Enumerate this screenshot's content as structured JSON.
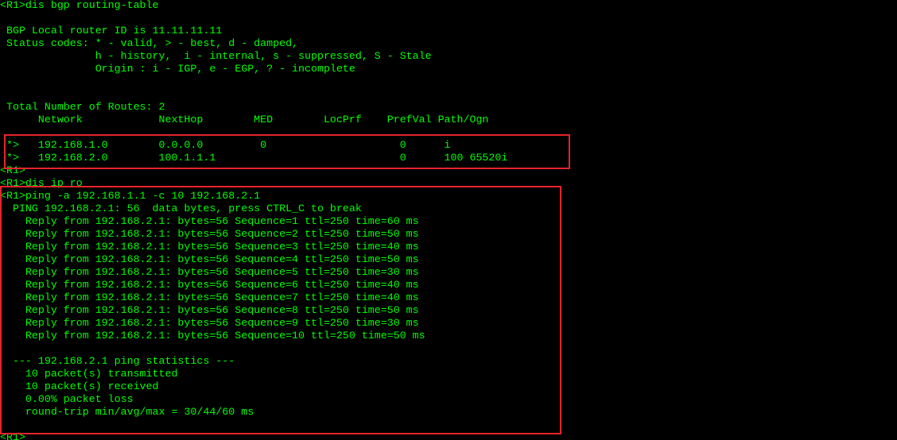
{
  "colors": {
    "background": "#000000",
    "text": "#00ff00",
    "highlight": "#e8232a"
  },
  "lines": [
    "<R1>dis bgp routing-table",
    "",
    " BGP Local router ID is 11.11.11.11",
    " Status codes: * - valid, > - best, d - damped,",
    "               h - history,  i - internal, s - suppressed, S - Stale",
    "               Origin : i - IGP, e - EGP, ? - incomplete",
    "",
    "",
    " Total Number of Routes: 2",
    "      Network            NextHop        MED        LocPrf    PrefVal Path/Ogn",
    "",
    " *>   192.168.1.0        0.0.0.0         0                     0      i",
    " *>   192.168.2.0        100.1.1.1                             0      100 65520i",
    "<R1>",
    "<R1>dis ip ro",
    "<R1>ping -a 192.168.1.1 -c 10 192.168.2.1",
    "  PING 192.168.2.1: 56  data bytes, press CTRL_C to break",
    "    Reply from 192.168.2.1: bytes=56 Sequence=1 ttl=250 time=60 ms",
    "    Reply from 192.168.2.1: bytes=56 Sequence=2 ttl=250 time=50 ms",
    "    Reply from 192.168.2.1: bytes=56 Sequence=3 ttl=250 time=40 ms",
    "    Reply from 192.168.2.1: bytes=56 Sequence=4 ttl=250 time=50 ms",
    "    Reply from 192.168.2.1: bytes=56 Sequence=5 ttl=250 time=30 ms",
    "    Reply from 192.168.2.1: bytes=56 Sequence=6 ttl=250 time=40 ms",
    "    Reply from 192.168.2.1: bytes=56 Sequence=7 ttl=250 time=40 ms",
    "    Reply from 192.168.2.1: bytes=56 Sequence=8 ttl=250 time=50 ms",
    "    Reply from 192.168.2.1: bytes=56 Sequence=9 ttl=250 time=30 ms",
    "    Reply from 192.168.2.1: bytes=56 Sequence=10 ttl=250 time=50 ms",
    "",
    "  --- 192.168.2.1 ping statistics ---",
    "    10 packet(s) transmitted",
    "    10 packet(s) received",
    "    0.00% packet loss",
    "    round-trip min/avg/max = 30/44/60 ms",
    "",
    "<R1>"
  ]
}
